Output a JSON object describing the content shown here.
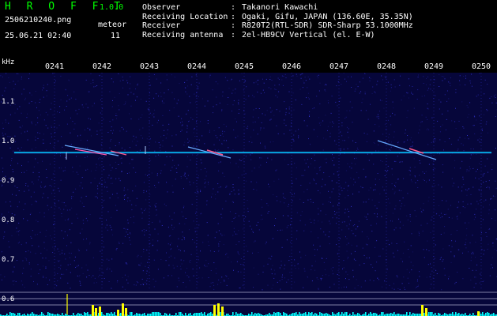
{
  "header": {
    "app_title": "H R O F F T",
    "app_version": "1.0.0",
    "filename": "2506210240.png",
    "timestamp": "25.06.21 02:40",
    "meteor_label": "meteor",
    "meteor_count": "11"
  },
  "info": [
    {
      "key": "Observer",
      "value": "Takanori Kawachi"
    },
    {
      "key": "Receiving Location",
      "value": "Ogaki, Gifu, JAPAN (136.60E, 35.35N)"
    },
    {
      "key": "Receiver",
      "value": "R820T2(RTL-SDR) SDR-Sharp 53.1000MHz"
    },
    {
      "key": "Receiving antenna",
      "value": "2el-HB9CV Vertical (el. E-W)"
    }
  ],
  "axis": {
    "freq_unit": "kHz",
    "time_ticks": [
      "0241",
      "0242",
      "0243",
      "0244",
      "0245",
      "0246",
      "0247",
      "0248",
      "0249",
      "0250"
    ],
    "freq_ticks": [
      "1.1",
      "1.0",
      "0.9",
      "0.8",
      "0.7",
      "0.6"
    ]
  },
  "colors": {
    "background": "#000000",
    "plot_background": "#06063a",
    "title_green": "#00ff00",
    "text": "#ffffff",
    "carrier": "#00ccff",
    "meteor_bar": "#ffff00",
    "baseline": "#00ffff"
  }
}
